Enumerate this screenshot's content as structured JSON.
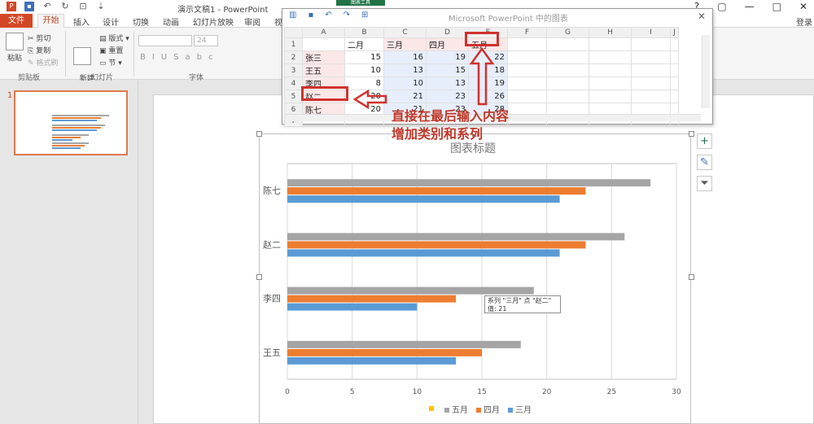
{
  "window": {
    "title": "演示文稿1 - PowerPoint",
    "controls": [
      "?",
      "▢",
      "—",
      "□",
      "✕"
    ]
  },
  "context_tab": "图表工具",
  "ribbon": {
    "tabs": [
      "文件",
      "开始",
      "插入",
      "设计",
      "切换",
      "动画",
      "幻灯片放映",
      "审阅",
      "视"
    ],
    "login": "登录",
    "clipboard": {
      "paste": "粘贴",
      "cut": "剪切",
      "copy": "复制",
      "format_painter": "格式刷",
      "group": "剪贴板"
    },
    "slides": {
      "new_slide": "新建\n幻灯片",
      "layout": "版式",
      "reset": "重置",
      "section": "节",
      "group": "幻灯片"
    },
    "font": {
      "size": "24",
      "group": "字体"
    }
  },
  "slide_panel": {
    "number": "1"
  },
  "data_dialog": {
    "title": "Microsoft PowerPoint 中的图表",
    "columns": [
      "",
      "A",
      "B",
      "C",
      "D",
      "E",
      "F",
      "G",
      "H",
      "I",
      "J"
    ],
    "rows": [
      [
        "1",
        "",
        "二月",
        "三月",
        "四月",
        "五月",
        "",
        "",
        "",
        "",
        ""
      ],
      [
        "2",
        "张三",
        "15",
        "16",
        "19",
        "22",
        "",
        "",
        "",
        "",
        ""
      ],
      [
        "3",
        "王五",
        "10",
        "13",
        "15",
        "18",
        "",
        "",
        "",
        "",
        ""
      ],
      [
        "4",
        "李四",
        "8",
        "10",
        "13",
        "19",
        "",
        "",
        "",
        "",
        ""
      ],
      [
        "5",
        "赵二",
        "20",
        "21",
        "23",
        "26",
        "",
        "",
        "",
        "",
        ""
      ],
      [
        "6",
        "陈七",
        "20",
        "21",
        "23",
        "28",
        "",
        "",
        "",
        "",
        ""
      ],
      [
        "7",
        "",
        "",
        "",
        "",
        "",
        "",
        "",
        "",
        "",
        ""
      ]
    ]
  },
  "annotation": {
    "line1": "直接在最后输入内容",
    "line2": "增加类别和系列"
  },
  "tooltip": {
    "line1": "系列 \"三月\" 点 \"赵二\"",
    "line2": "值: 21"
  },
  "chart_data": {
    "type": "bar",
    "orientation": "horizontal",
    "title": "图表标题",
    "categories": [
      "王五",
      "李四",
      "赵二",
      "陈七"
    ],
    "series": [
      {
        "name": "三月",
        "color": "#5b9bd5",
        "values": [
          13,
          10,
          21,
          21
        ]
      },
      {
        "name": "四月",
        "color": "#ed7d31",
        "values": [
          15,
          13,
          23,
          23
        ]
      },
      {
        "name": "五月",
        "color": "#a5a5a5",
        "values": [
          18,
          19,
          26,
          28
        ]
      }
    ],
    "legend_order": [
      "五月",
      "四月",
      "三月"
    ],
    "legend_colors": [
      "#ffc000",
      "#a5a5a5",
      "#ed7d31",
      "#5b9bd5"
    ],
    "xlim": [
      0,
      30
    ],
    "xticks": [
      "0",
      "5",
      "10",
      "15",
      "20",
      "25",
      "30"
    ],
    "grid": true,
    "legend": "bottom"
  }
}
